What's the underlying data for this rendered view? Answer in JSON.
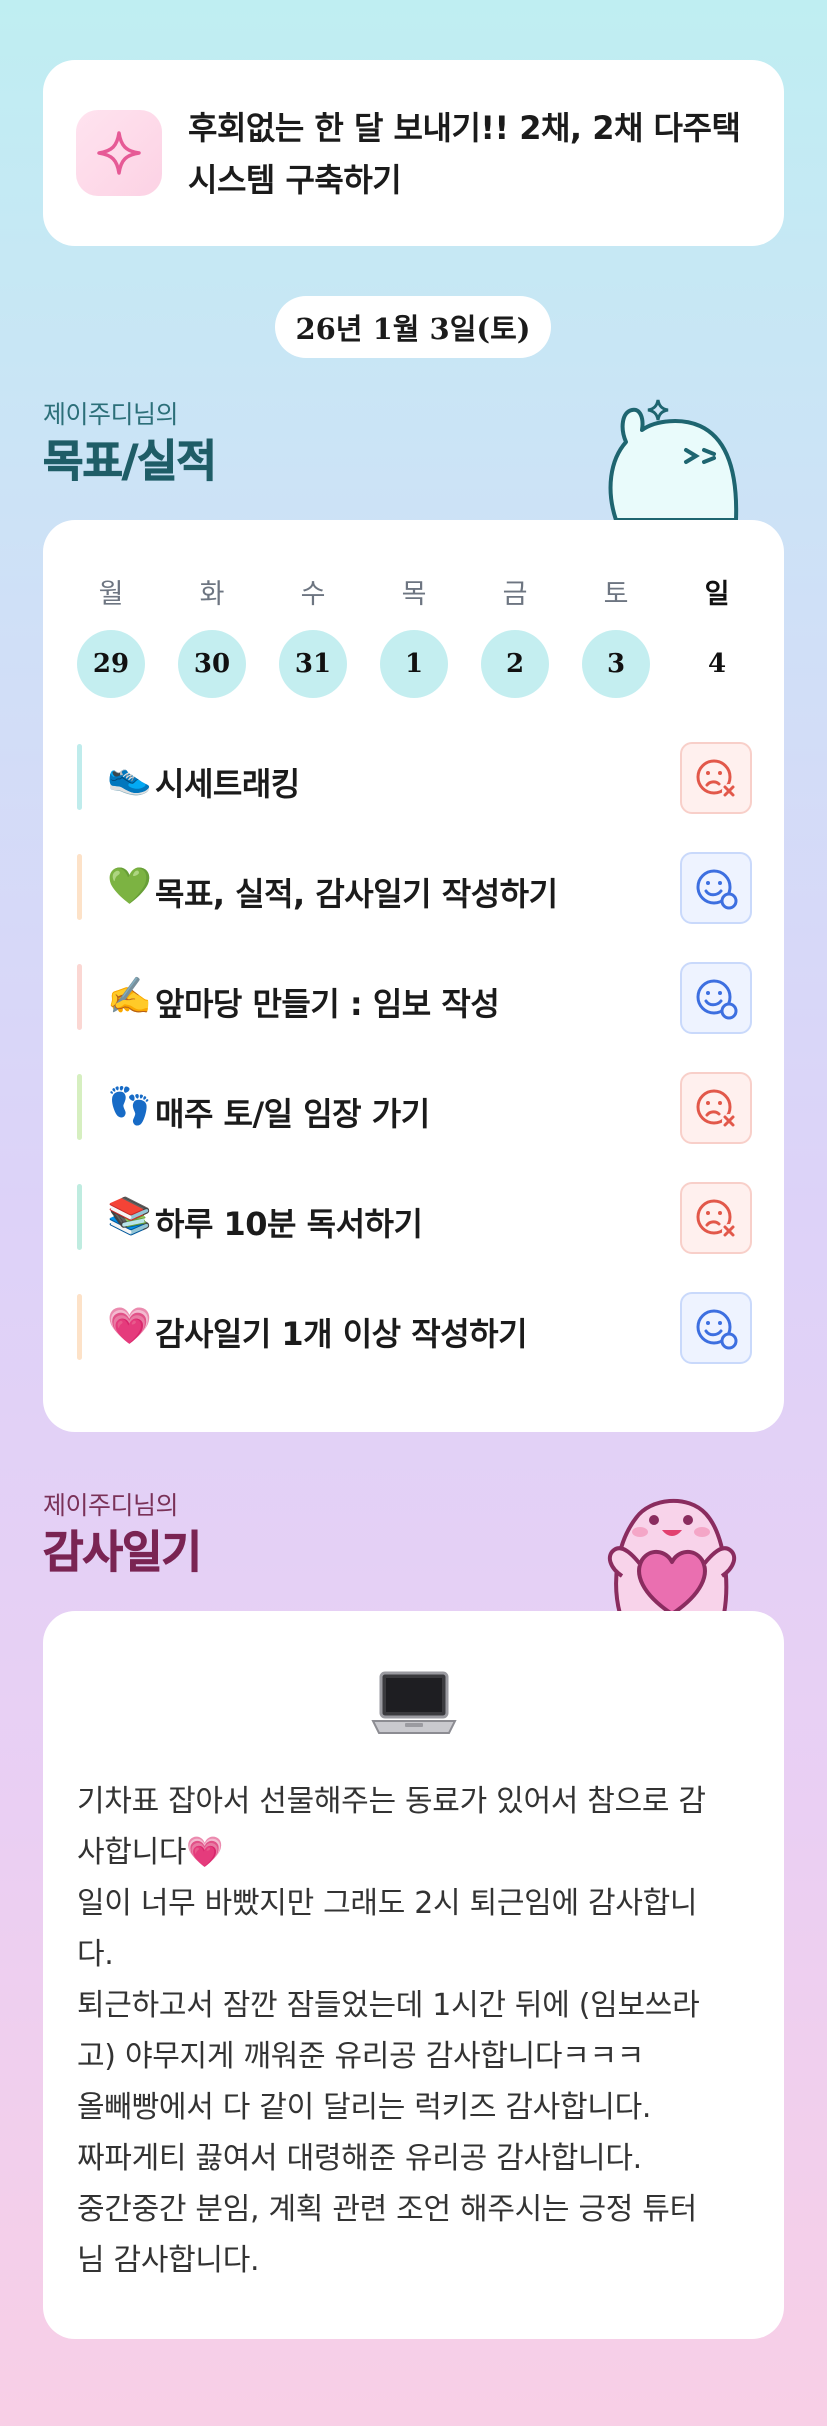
{
  "header": {
    "title": "후회없는 한 달 보내기!! 2채, 2채 다주택\n시스템 구축하기",
    "icon": "sparkle-icon"
  },
  "date": "26년 1월 3일(토)",
  "goals_section": {
    "subtitle": "제이주디님의",
    "title": "목표/실적"
  },
  "calendar": {
    "days": [
      {
        "name": "월",
        "num": "29"
      },
      {
        "name": "화",
        "num": "30"
      },
      {
        "name": "수",
        "num": "31"
      },
      {
        "name": "목",
        "num": "1"
      },
      {
        "name": "금",
        "num": "2"
      },
      {
        "name": "토",
        "num": "3"
      },
      {
        "name": "일",
        "num": "4"
      }
    ]
  },
  "goals": [
    {
      "emoji": "👟",
      "label": "시세트래킹",
      "status": "fail"
    },
    {
      "emoji": "💚",
      "label": "목표, 실적, 감사일기 작성하기",
      "status": "done"
    },
    {
      "emoji": "✍️",
      "label": "앞마당 만들기 : 임보 작성",
      "status": "done"
    },
    {
      "emoji": "👣",
      "label": "매주 토/일 임장 가기",
      "status": "fail"
    },
    {
      "emoji": "📚",
      "label": "하루 10분 독서하기",
      "status": "fail"
    },
    {
      "emoji": "💗",
      "label": "감사일기 1개 이상 작성하기",
      "status": "done"
    }
  ],
  "thanks_section": {
    "subtitle": "제이주디님의",
    "title": "감사일기",
    "icon": "laptop-icon",
    "text": "기차표 잡아서 선물해주는 동료가 있어서 참으로 감\n사합니다💗\n일이 너무 바빴지만 그래도 2시 퇴근임에 감사합니\n다.\n퇴근하고서 잠깐 잠들었는데 1시간 뒤에 (임보쓰라\n고) 야무지게 깨워준 유리공 감사합니다ㅋㅋㅋ\n올빼빵에서 다 같이 달리는 럭키즈 감사합니다.\n짜파게티 끓여서 대령해준 유리공 감사합니다.\n중간중간 분임, 계획 관련 조언 해주시는 긍정 튜터\n님 감사합니다."
  },
  "colors": {
    "goal_title": "#1f5d67",
    "thanks_title": "#7a2453",
    "day_fill": "#c4eef0",
    "fail": "#e2584a",
    "done": "#3d6fe0"
  }
}
